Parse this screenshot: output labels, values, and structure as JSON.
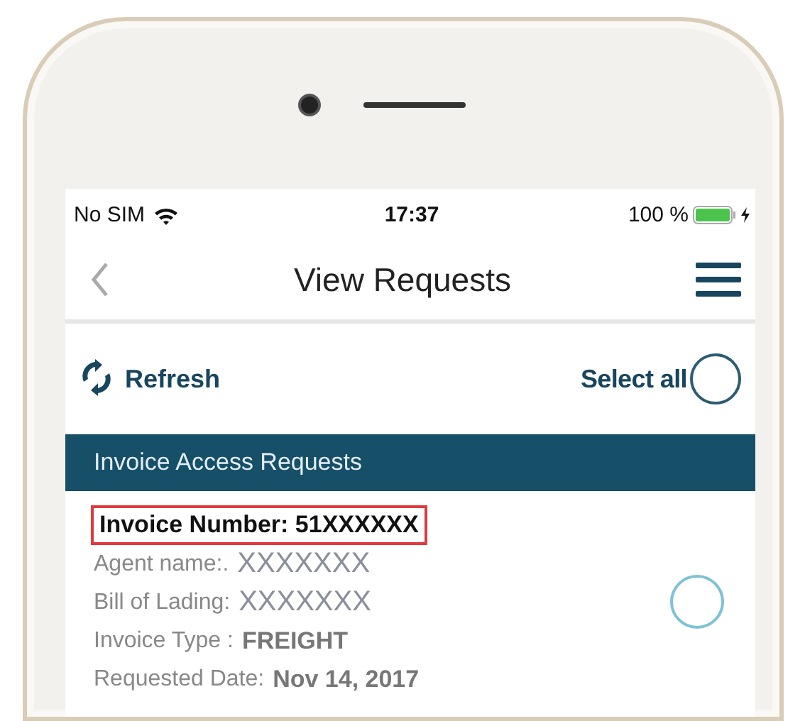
{
  "status_bar": {
    "carrier": "No SIM",
    "time": "17:37",
    "battery": "100 %"
  },
  "nav": {
    "title": "View Requests"
  },
  "toolbar": {
    "refresh": "Refresh",
    "select_all": {
      "label": "Select all",
      "selected": false
    }
  },
  "section": {
    "title": "Invoice Access Requests"
  },
  "requests": [
    {
      "invoice_number": "Invoice Number: 51XXXXXX",
      "highlighted": true,
      "selected": false,
      "fields": [
        {
          "label": "Agent name:.",
          "value": "XXXXXXX",
          "kind": "masked"
        },
        {
          "label": "Bill of Lading:",
          "value": "XXXXXXX",
          "kind": "masked"
        },
        {
          "label": "Invoice Type :",
          "value": "FREIGHT",
          "kind": "bold"
        },
        {
          "label": "Requested Date:",
          "value": "Nov 14, 2017",
          "kind": "bold"
        }
      ]
    }
  ]
}
